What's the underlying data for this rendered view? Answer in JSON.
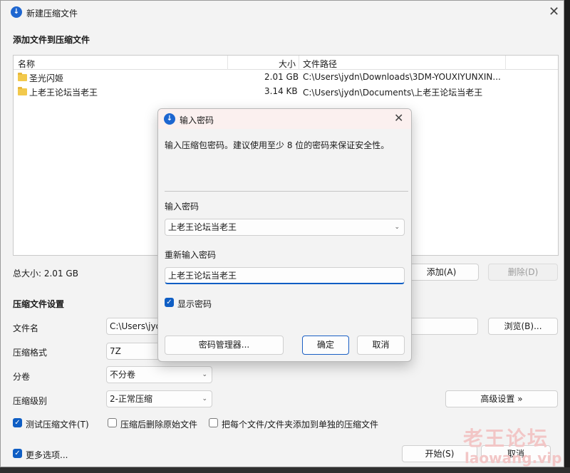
{
  "main_window": {
    "title": "新建压缩文件",
    "close_glyph": "✕",
    "add_section_label": "添加文件到压缩文件",
    "file_list": {
      "columns": [
        "名称",
        "大小",
        "文件路径"
      ],
      "rows": [
        {
          "name": "圣光闪姬",
          "size": "2.01 GB",
          "path": "C:\\Users\\jydn\\Downloads\\3DM-YOUXIYUNXIN..."
        },
        {
          "name": "上老王论坛当老王",
          "size": "3.14 KB",
          "path": "C:\\Users\\jydn\\Documents\\上老王论坛当老王"
        }
      ]
    },
    "total_size": "总大小: 2.01 GB",
    "add_button": "添加(A)",
    "delete_button": "删除(D)",
    "settings_label": "压缩文件设置",
    "filename_label": "文件名",
    "filename_value": "C:\\Users\\jyd",
    "browse_button": "浏览(B)...",
    "format_label": "压缩格式",
    "format_value": "7Z",
    "volume_label": "分卷",
    "volume_value": "不分卷",
    "level_label": "压缩级别",
    "level_value": "2-正常压缩",
    "advanced_button": "高级设置 »",
    "check_test": "测试压缩文件(T)",
    "check_delete_after": "压缩后删除原始文件",
    "check_each_separate": "把每个文件/文件夹添加到单独的压缩文件",
    "more_options": "更多选项...",
    "start_button": "开始(S)",
    "cancel_button": "取消"
  },
  "password_dialog": {
    "title": "输入密码",
    "close_glyph": "✕",
    "description": "输入压缩包密码。建议使用至少 8 位的密码来保证安全性。",
    "password_label": "输入密码",
    "password_value": "上老王论坛当老王",
    "confirm_label": "重新输入密码",
    "confirm_value": "上老王论坛当老王",
    "show_password": "显示密码",
    "manager_button": "密码管理器...",
    "ok_button": "确定",
    "cancel_button": "取消"
  },
  "watermark": {
    "line1": "老王论坛",
    "line2": "laowang.vip"
  },
  "colors": {
    "accent": "#0f5ec4",
    "dialog_title_bg": "#fbf0ef",
    "folder": "#f2c94c"
  }
}
